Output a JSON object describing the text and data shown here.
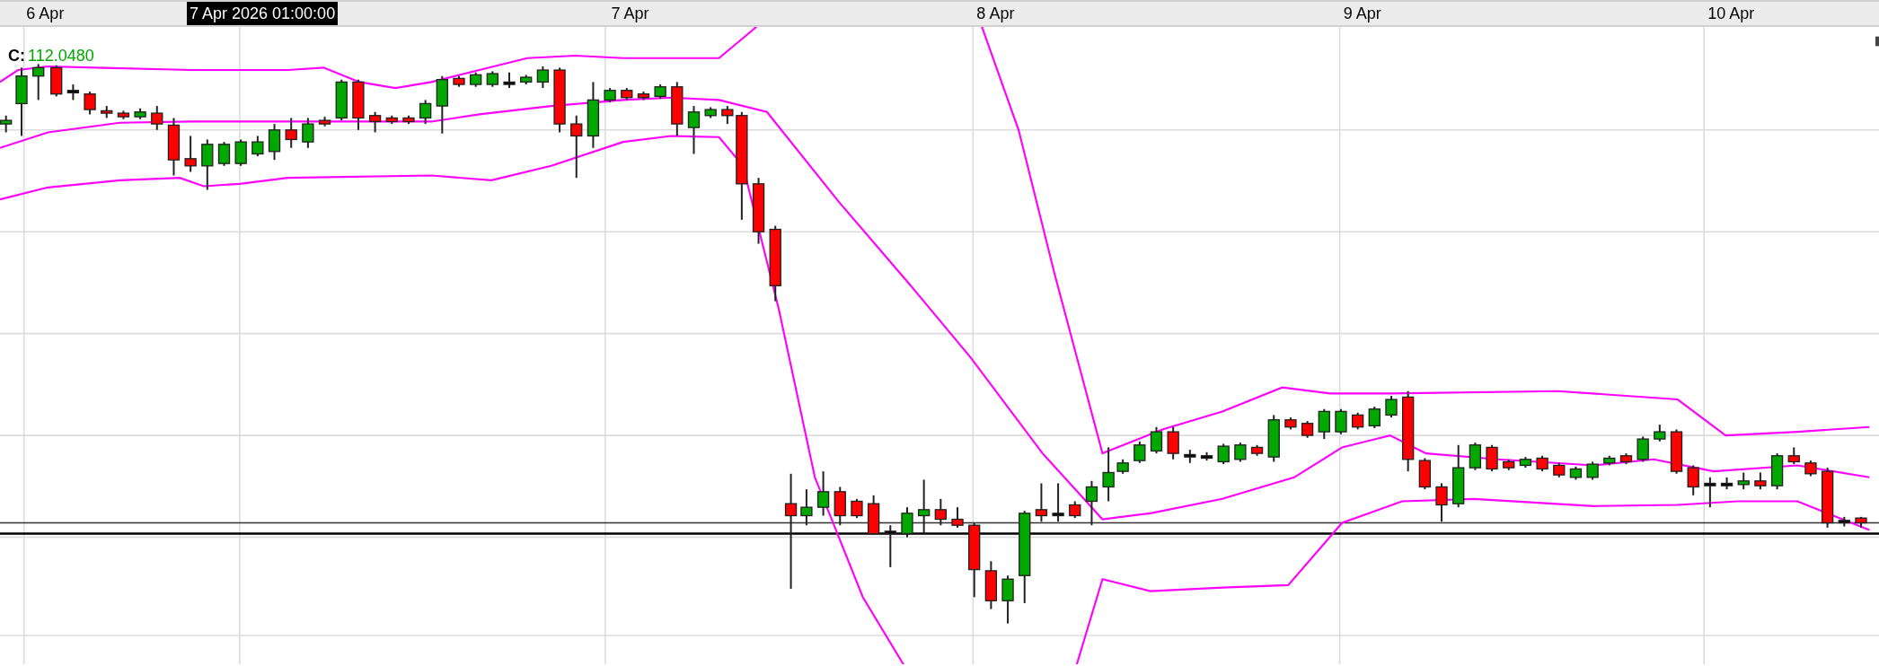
{
  "time_axis": {
    "labels": [
      "6 Apr",
      "7 Apr",
      "8 Apr",
      "9 Apr",
      "10 Apr"
    ],
    "cursor_label": "7 Apr 2026 01:00:00"
  },
  "legend": {
    "label": "C:",
    "value": "112.0480"
  }
}
